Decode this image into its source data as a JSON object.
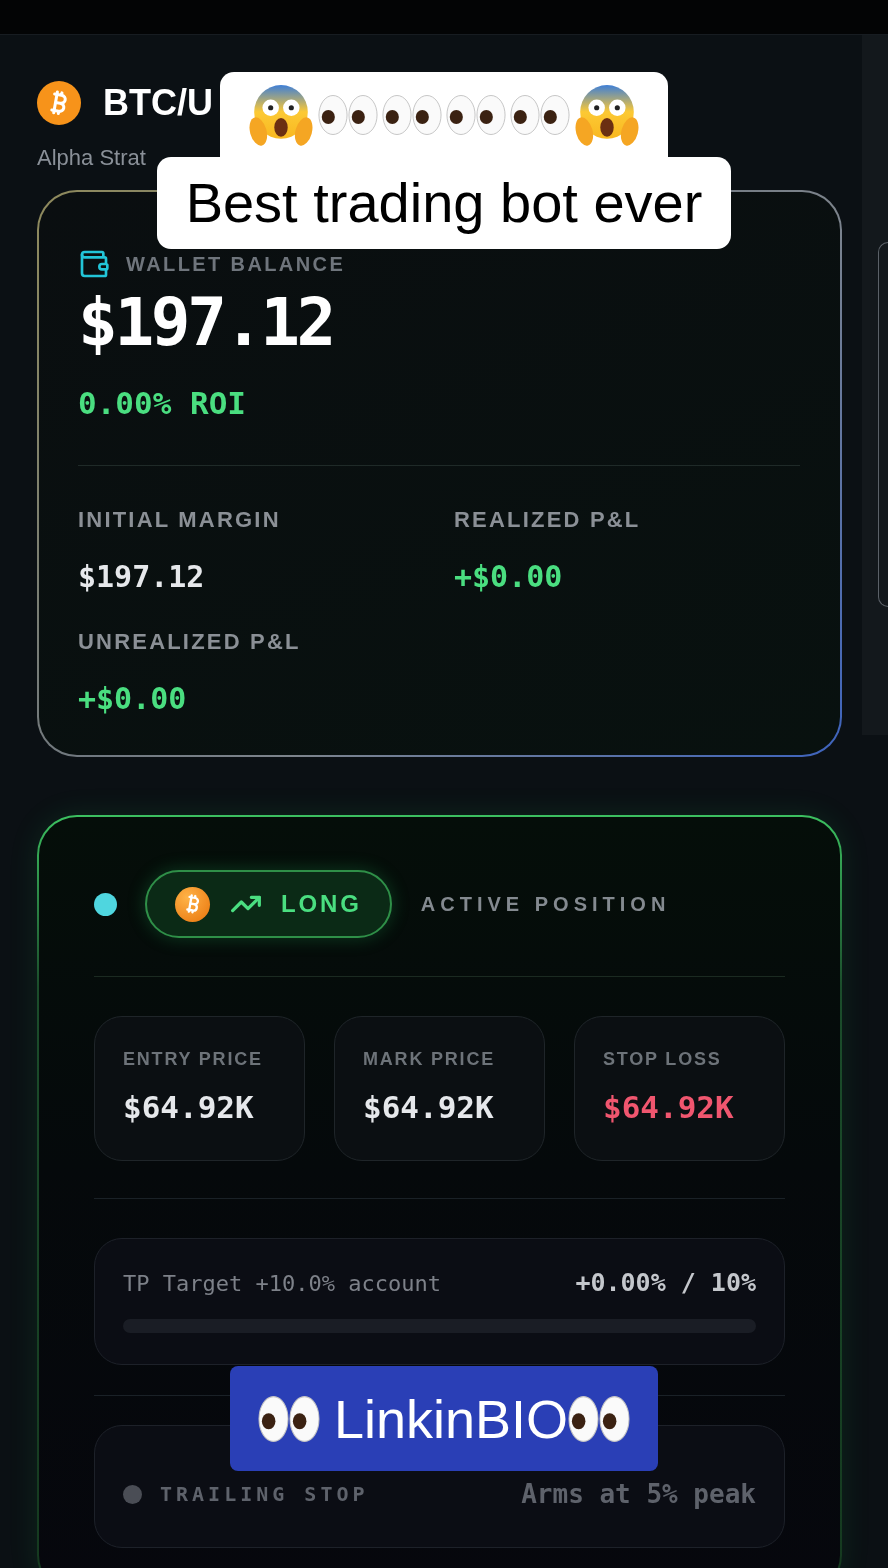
{
  "header": {
    "pair": "BTC/U",
    "subtitle": "Alpha Strat"
  },
  "wallet": {
    "label": "WALLET BALANCE",
    "balance": "$197.12",
    "roi": "0.00% ROI",
    "stats": [
      {
        "label": "INITIAL MARGIN",
        "value": "$197.12",
        "kind": "neutral"
      },
      {
        "label": "REALIZED P&L",
        "value": "+$0.00",
        "kind": "positive"
      },
      {
        "label": "UNREALIZED P&L",
        "value": "+$0.00",
        "kind": "positive"
      }
    ]
  },
  "position": {
    "live": true,
    "side": {
      "label": "LONG",
      "kind": "long"
    },
    "title": "ACTIVE POSITION",
    "prices": [
      {
        "label": "ENTRY PRICE",
        "value": "$64.92K",
        "kind": "neutral"
      },
      {
        "label": "MARK PRICE",
        "value": "$64.92K",
        "kind": "neutral"
      },
      {
        "label": "STOP LOSS",
        "value": "$64.92K",
        "kind": "negative"
      }
    ],
    "tp_target": {
      "label": "TP Target +10.0% account",
      "reading": "+0.00% / 10%",
      "level": 0
    },
    "trailing_stop": {
      "label": "TRAILING STOP",
      "reading": "Arms at 5% peak",
      "active": false
    }
  },
  "captions": {
    "top": [
      {
        "kind": "emoji"
      },
      {
        "kind": "text",
        "text": "Best trading bot ever"
      }
    ],
    "bottom": {
      "text": "LinkinBIO"
    }
  }
}
